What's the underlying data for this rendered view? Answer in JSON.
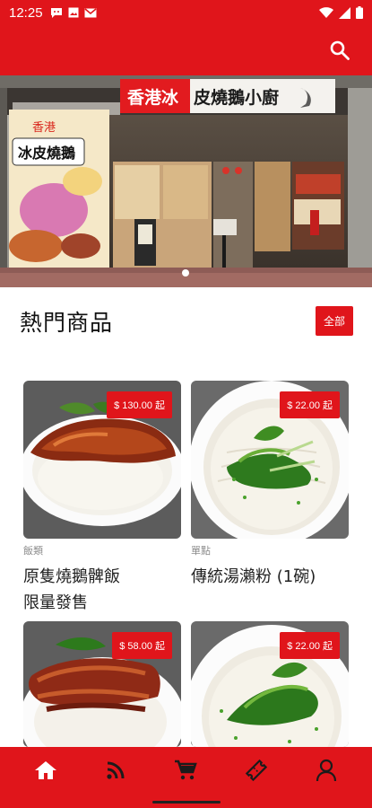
{
  "status_bar": {
    "time": "12:25",
    "left_icons": [
      "chat-bubble-icon",
      "photo-notification-icon",
      "gmail-icon"
    ],
    "right_icons": [
      "wifi-icon",
      "cell-signal-icon",
      "battery-icon"
    ]
  },
  "app_bar": {
    "search_icon": "search-icon"
  },
  "hero": {
    "sign_red": "香港冰",
    "sign_black": "皮燒鵝小廚",
    "poster_line1": "香港",
    "poster_line2": "冰皮燒鵝",
    "carousel_dots": 2,
    "active_dot": 1
  },
  "section": {
    "title": "熱門商品",
    "all_label": "全部"
  },
  "products": [
    {
      "price": "$ 130.00 起",
      "category": "飯類",
      "name_line1": "原隻燒鵝髀飯",
      "name_line2": "限量發售"
    },
    {
      "price": "$ 22.00 起",
      "category": "單點",
      "name_line1": "傳統湯瀨粉 (1碗)",
      "name_line2": ""
    },
    {
      "price": "$ 58.00 起",
      "category": "",
      "name_line1": "",
      "name_line2": ""
    },
    {
      "price": "$ 22.00 起",
      "category": "",
      "name_line1": "",
      "name_line2": ""
    }
  ],
  "bottom_nav": [
    "home-icon",
    "rss-feed-icon",
    "cart-icon",
    "coupon-ticket-icon",
    "profile-icon"
  ],
  "colors": {
    "brand_red": "#e0151b",
    "text": "#222222",
    "muted": "#8c8c8c"
  }
}
